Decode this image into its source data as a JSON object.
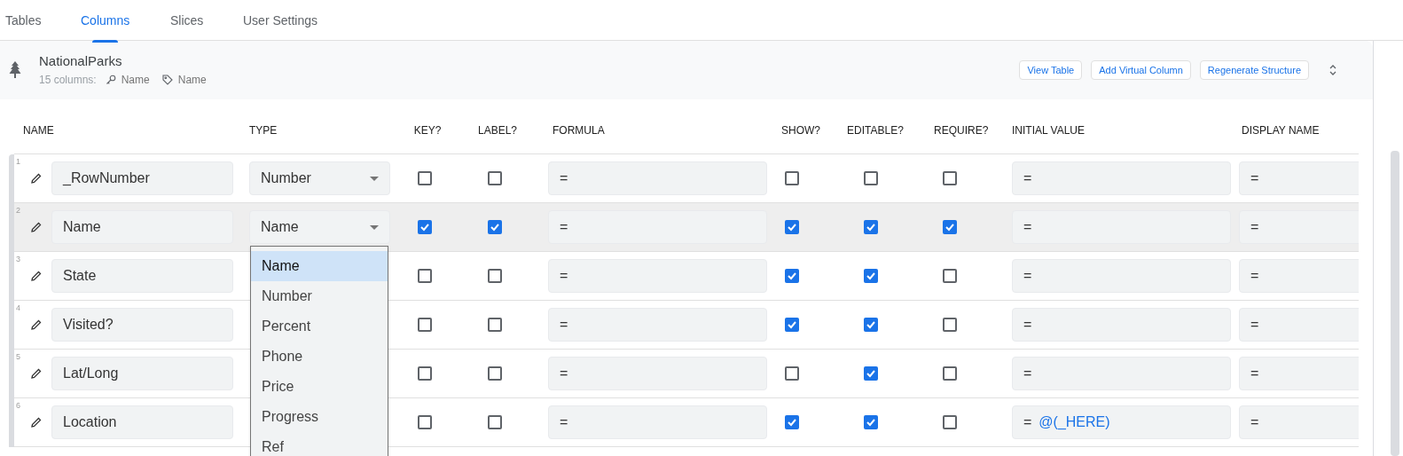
{
  "tabs": [
    {
      "label": "Tables",
      "selected": false
    },
    {
      "label": "Columns",
      "selected": true
    },
    {
      "label": "Slices",
      "selected": false
    },
    {
      "label": "User Settings",
      "selected": false
    }
  ],
  "table_panel": {
    "title": "NationalParks",
    "column_count": "15 columns:",
    "key_column": "Name",
    "label_column": "Name",
    "buttons": [
      "View Table",
      "Add Virtual Column",
      "Regenerate Structure"
    ]
  },
  "column_headers": [
    "NAME",
    "TYPE",
    "KEY?",
    "LABEL?",
    "FORMULA",
    "SHOW?",
    "EDITABLE?",
    "REQUIRE?",
    "INITIAL VALUE",
    "DISPLAY NAME"
  ],
  "rows": [
    {
      "number": "1",
      "name": "_RowNumber",
      "type": "Number",
      "selected": false,
      "key": false,
      "label": false,
      "formula": "=",
      "show": false,
      "editable": false,
      "require": false,
      "initial_value": {
        "prefix": "="
      },
      "display_name": "="
    },
    {
      "number": "2",
      "name": "Name",
      "type": "Name",
      "selected": true,
      "key": true,
      "label": true,
      "formula": "=",
      "show": true,
      "editable": true,
      "require": true,
      "initial_value": {
        "prefix": "="
      },
      "display_name": "=",
      "type_menu": [
        {
          "label": "Name",
          "selected": true
        },
        {
          "label": "Number",
          "selected": false
        },
        {
          "label": "Percent",
          "selected": false
        },
        {
          "label": "Phone",
          "selected": false
        },
        {
          "label": "Price",
          "selected": false
        },
        {
          "label": "Progress",
          "selected": false
        },
        {
          "label": "Ref",
          "selected": false
        }
      ]
    },
    {
      "number": "3",
      "name": "State",
      "selected": false,
      "key": false,
      "label": false,
      "formula": "=",
      "show": true,
      "editable": true,
      "require": false,
      "initial_value": {
        "prefix": "="
      },
      "display_name": "="
    },
    {
      "number": "4",
      "name": "Visited?",
      "selected": false,
      "key": false,
      "label": false,
      "formula": "=",
      "show": true,
      "editable": true,
      "require": false,
      "initial_value": {
        "prefix": "="
      },
      "display_name": "="
    },
    {
      "number": "5",
      "name": "Lat/Long",
      "selected": false,
      "key": false,
      "label": false,
      "formula": "=",
      "show": false,
      "editable": true,
      "require": false,
      "initial_value": {
        "prefix": "="
      },
      "display_name": "="
    },
    {
      "number": "6",
      "name": "Location",
      "selected": false,
      "key": false,
      "label": false,
      "formula": "=",
      "show": true,
      "editable": true,
      "require": false,
      "initial_value": {
        "prefix": "=",
        "expression": "@(_HERE)"
      },
      "display_name": "="
    }
  ]
}
